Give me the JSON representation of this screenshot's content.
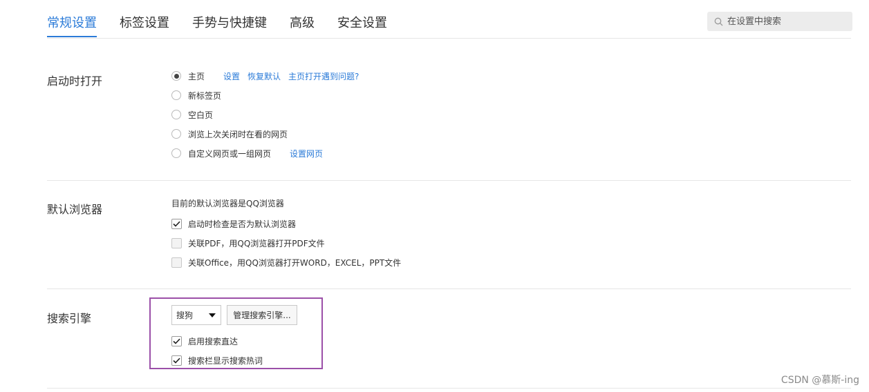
{
  "tabs": [
    {
      "label": "常规设置",
      "active": true
    },
    {
      "label": "标签设置",
      "active": false
    },
    {
      "label": "手势与快捷键",
      "active": false
    },
    {
      "label": "高级",
      "active": false
    },
    {
      "label": "安全设置",
      "active": false
    }
  ],
  "search": {
    "placeholder": "在设置中搜索",
    "icon": "search-icon"
  },
  "startup": {
    "title": "启动时打开",
    "options": [
      {
        "label": "主页",
        "checked": true
      },
      {
        "label": "新标签页",
        "checked": false
      },
      {
        "label": "空白页",
        "checked": false
      },
      {
        "label": "浏览上次关闭时在看的网页",
        "checked": false
      },
      {
        "label": "自定义网页或一组网页",
        "checked": false
      }
    ],
    "links": {
      "set": "设置",
      "restore": "恢复默认",
      "help": "主页打开遇到问题?",
      "set_pages": "设置网页"
    }
  },
  "default_browser": {
    "title": "默认浏览器",
    "status": "目前的默认浏览器是QQ浏览器",
    "options": [
      {
        "label": "启动时检查是否为默认浏览器",
        "checked": true
      },
      {
        "label": "关联PDF，用QQ浏览器打开PDF文件",
        "checked": false
      },
      {
        "label": "关联Office，用QQ浏览器打开WORD，EXCEL，PPT文件",
        "checked": false
      }
    ]
  },
  "search_engine": {
    "title": "搜索引擎",
    "selected": "搜狗",
    "manage_button": "管理搜索引擎...",
    "options": [
      {
        "label": "启用搜索直达",
        "checked": true
      },
      {
        "label": "搜索栏显示搜索热词",
        "checked": true
      }
    ],
    "highlight_color": "#9b4fa8"
  },
  "accent_color": "#2b7bd8",
  "watermark": "CSDN @慕斯-ing"
}
